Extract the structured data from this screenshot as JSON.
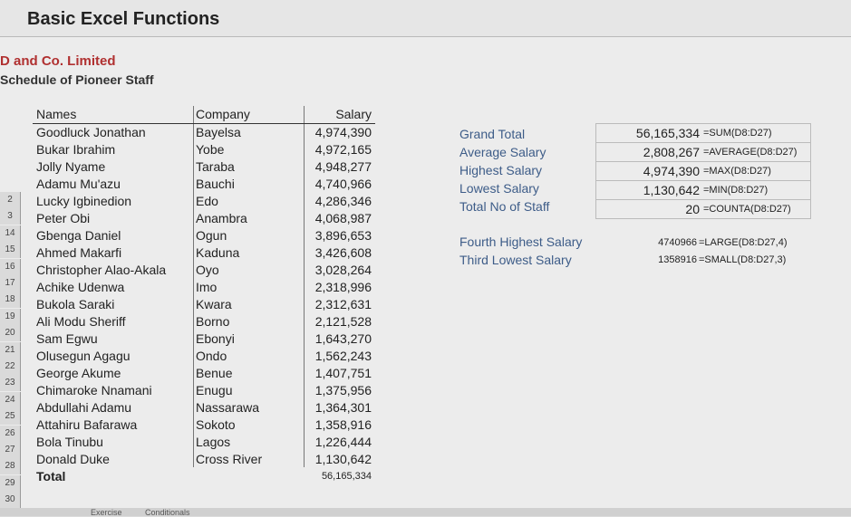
{
  "app_title": "Basic Excel Functions",
  "company_name": "D and Co. Limited",
  "schedule_title": "Schedule of Pioneer Staff",
  "row_numbers": [
    "",
    "",
    "",
    "",
    "",
    "2",
    "3",
    "14",
    "15",
    "16",
    "17",
    "18",
    "19",
    "20",
    "21",
    "22",
    "23",
    "24",
    "25",
    "26",
    "27",
    "28",
    "29",
    "30"
  ],
  "table": {
    "headers": {
      "name": "Names",
      "company": "Company",
      "salary": "Salary"
    },
    "rows": [
      {
        "name": "Goodluck Jonathan",
        "company": "Bayelsa",
        "salary": "4,974,390"
      },
      {
        "name": "Bukar Ibrahim",
        "company": "Yobe",
        "salary": "4,972,165"
      },
      {
        "name": "Jolly Nyame",
        "company": "Taraba",
        "salary": "4,948,277"
      },
      {
        "name": "Adamu Mu'azu",
        "company": "Bauchi",
        "salary": "4,740,966"
      },
      {
        "name": "Lucky Igbinedion",
        "company": "Edo",
        "salary": "4,286,346"
      },
      {
        "name": "Peter Obi",
        "company": "Anambra",
        "salary": "4,068,987"
      },
      {
        "name": "Gbenga Daniel",
        "company": "Ogun",
        "salary": "3,896,653"
      },
      {
        "name": "Ahmed Makarfi",
        "company": "Kaduna",
        "salary": "3,426,608"
      },
      {
        "name": "Christopher Alao-Akala",
        "company": "Oyo",
        "salary": "3,028,264"
      },
      {
        "name": "Achike Udenwa",
        "company": "Imo",
        "salary": "2,318,996"
      },
      {
        "name": "Bukola Saraki",
        "company": "Kwara",
        "salary": "2,312,631"
      },
      {
        "name": "Ali Modu Sheriff",
        "company": "Borno",
        "salary": "2,121,528"
      },
      {
        "name": "Sam Egwu",
        "company": "Ebonyi",
        "salary": "1,643,270"
      },
      {
        "name": "Olusegun Agagu",
        "company": "Ondo",
        "salary": "1,562,243"
      },
      {
        "name": "George Akume",
        "company": "Benue",
        "salary": "1,407,751"
      },
      {
        "name": "Chimaroke Nnamani",
        "company": "Enugu",
        "salary": "1,375,956"
      },
      {
        "name": "Abdullahi Adamu",
        "company": "Nassarawa",
        "salary": "1,364,301"
      },
      {
        "name": "Attahiru Bafarawa",
        "company": "Sokoto",
        "salary": "1,358,916"
      },
      {
        "name": "Bola Tinubu",
        "company": "Lagos",
        "salary": "1,226,444"
      },
      {
        "name": "Donald Duke",
        "company": "Cross River",
        "salary": "1,130,642"
      }
    ],
    "total": {
      "label": "Total",
      "value": "56,165,334"
    }
  },
  "stats": [
    {
      "label": "Grand Total",
      "value": "56,165,334",
      "formula": "=SUM(D8:D27)"
    },
    {
      "label": "Average Salary",
      "value": "2,808,267",
      "formula": "=AVERAGE(D8:D27)"
    },
    {
      "label": "Highest Salary",
      "value": "4,974,390",
      "formula": "=MAX(D8:D27)"
    },
    {
      "label": "Lowest Salary",
      "value": "1,130,642",
      "formula": "=MIN(D8:D27)"
    },
    {
      "label": "Total No of Staff",
      "value": "20",
      "formula": "=COUNTA(D8:D27)"
    }
  ],
  "rank_stats": [
    {
      "label": "Fourth Highest Salary",
      "value": "4740966",
      "formula": "=LARGE(D8:D27,4)"
    },
    {
      "label": "Third Lowest Salary",
      "value": "1358916",
      "formula": "=SMALL(D8:D27,3)"
    }
  ],
  "sheet_tabs": [
    "Exercise",
    "Conditionals"
  ]
}
